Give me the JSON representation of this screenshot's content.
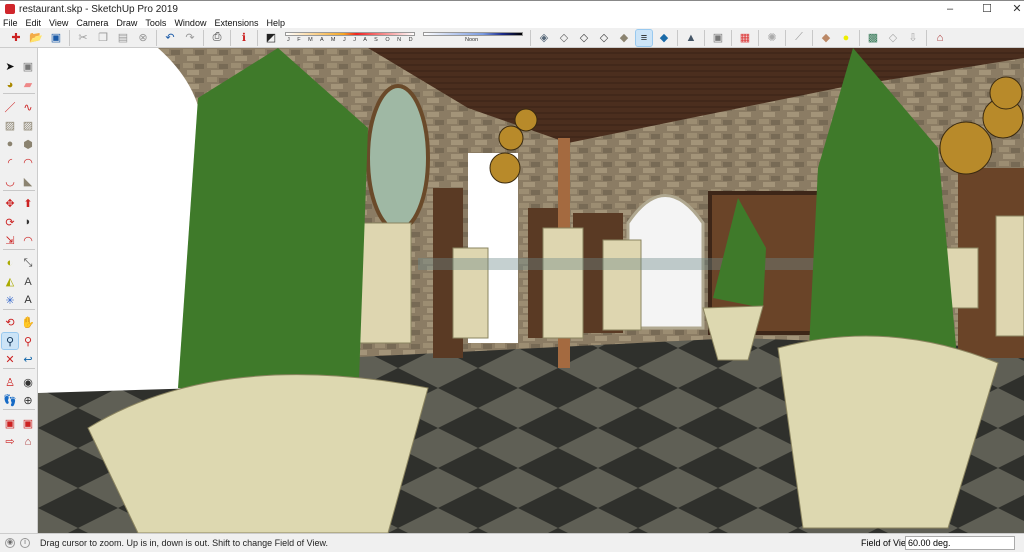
{
  "window": {
    "title": "restaurant.skp - SketchUp Pro 2019",
    "controls": {
      "minimize": "–",
      "maximize": "☐",
      "close": "✕"
    }
  },
  "menu": [
    "File",
    "Edit",
    "View",
    "Camera",
    "Draw",
    "Tools",
    "Window",
    "Extensions",
    "Help"
  ],
  "toolbar": {
    "items": [
      "new-icon",
      "open-icon",
      "save-icon",
      "|",
      "cut-icon",
      "copy-icon",
      "paste-icon",
      "erase-icon",
      "|",
      "undo-icon",
      "redo-icon",
      "|",
      "print-icon",
      "|",
      "model-info-icon",
      "|",
      "shadows-toggle-icon"
    ],
    "shadow_months": "J F M A M J J A S O N D",
    "shadow_time": "Noon",
    "items2": [
      "xray-icon",
      "back-edges-icon",
      "wireframe-icon",
      "hidden-line-icon",
      "shaded-icon",
      "shaded-textures-icon",
      "monochrome-icon",
      "|",
      "warehouse-icon",
      "|",
      "component-icon",
      "|",
      "materials-icon",
      "|",
      "sandbox-icon",
      "|",
      "measure-icon",
      "|",
      "styles-icon",
      "light-icon",
      "|",
      "geo-location-icon",
      "photo-texture-icon",
      "extension-icon",
      "|",
      "extension-warehouse-icon"
    ],
    "active": "shaded-textures-icon"
  },
  "left_toolbar": {
    "groups": [
      [
        [
          "select-icon",
          "component-icon"
        ],
        [
          "paint-bucket-icon",
          "eraser-icon"
        ]
      ],
      [
        [
          "line-icon",
          "freehand-icon"
        ],
        [
          "rectangle-icon",
          "rotated-rectangle-icon"
        ],
        [
          "circle-icon",
          "polygon-icon"
        ],
        [
          "arc-icon",
          "two-point-arc-icon"
        ],
        [
          "three-point-arc-icon",
          "pie-icon"
        ]
      ],
      [
        [
          "move-icon",
          "push-pull-icon"
        ],
        [
          "rotate-icon",
          "follow-me-icon"
        ],
        [
          "scale-icon",
          "offset-icon"
        ]
      ],
      [
        [
          "tape-measure-icon",
          "dimension-icon"
        ],
        [
          "protractor-icon",
          "text-icon"
        ],
        [
          "axes-icon",
          "3d-text-icon"
        ]
      ],
      [
        [
          "orbit-icon",
          "pan-icon"
        ],
        [
          "zoom-icon",
          "zoom-window-icon"
        ],
        [
          "zoom-extents-icon",
          "previous-view-icon"
        ]
      ],
      [
        [
          "position-camera-icon",
          "look-around-icon"
        ],
        [
          "walk-icon",
          "section-plane-icon"
        ]
      ],
      [
        [
          "send-to-layout-icon",
          "3d-warehouse-icon"
        ],
        [
          "share-model-icon",
          "extension-warehouse-icon"
        ]
      ]
    ],
    "active": "zoom-icon"
  },
  "status": {
    "message": "Drag cursor to zoom.  Up is in, down is out. Shift to change Field of View.",
    "fov_label": "Field of View",
    "fov_value": "60.00 deg."
  },
  "colors": {
    "accent": "#cce4f7",
    "ceiling": "#4a2f1f",
    "stone": "#8a7a62",
    "floor_dark": "#3a3a35",
    "floor_light": "#6e6e62",
    "foliage": "#3f7a2a",
    "pot": "#ddd8b0"
  }
}
